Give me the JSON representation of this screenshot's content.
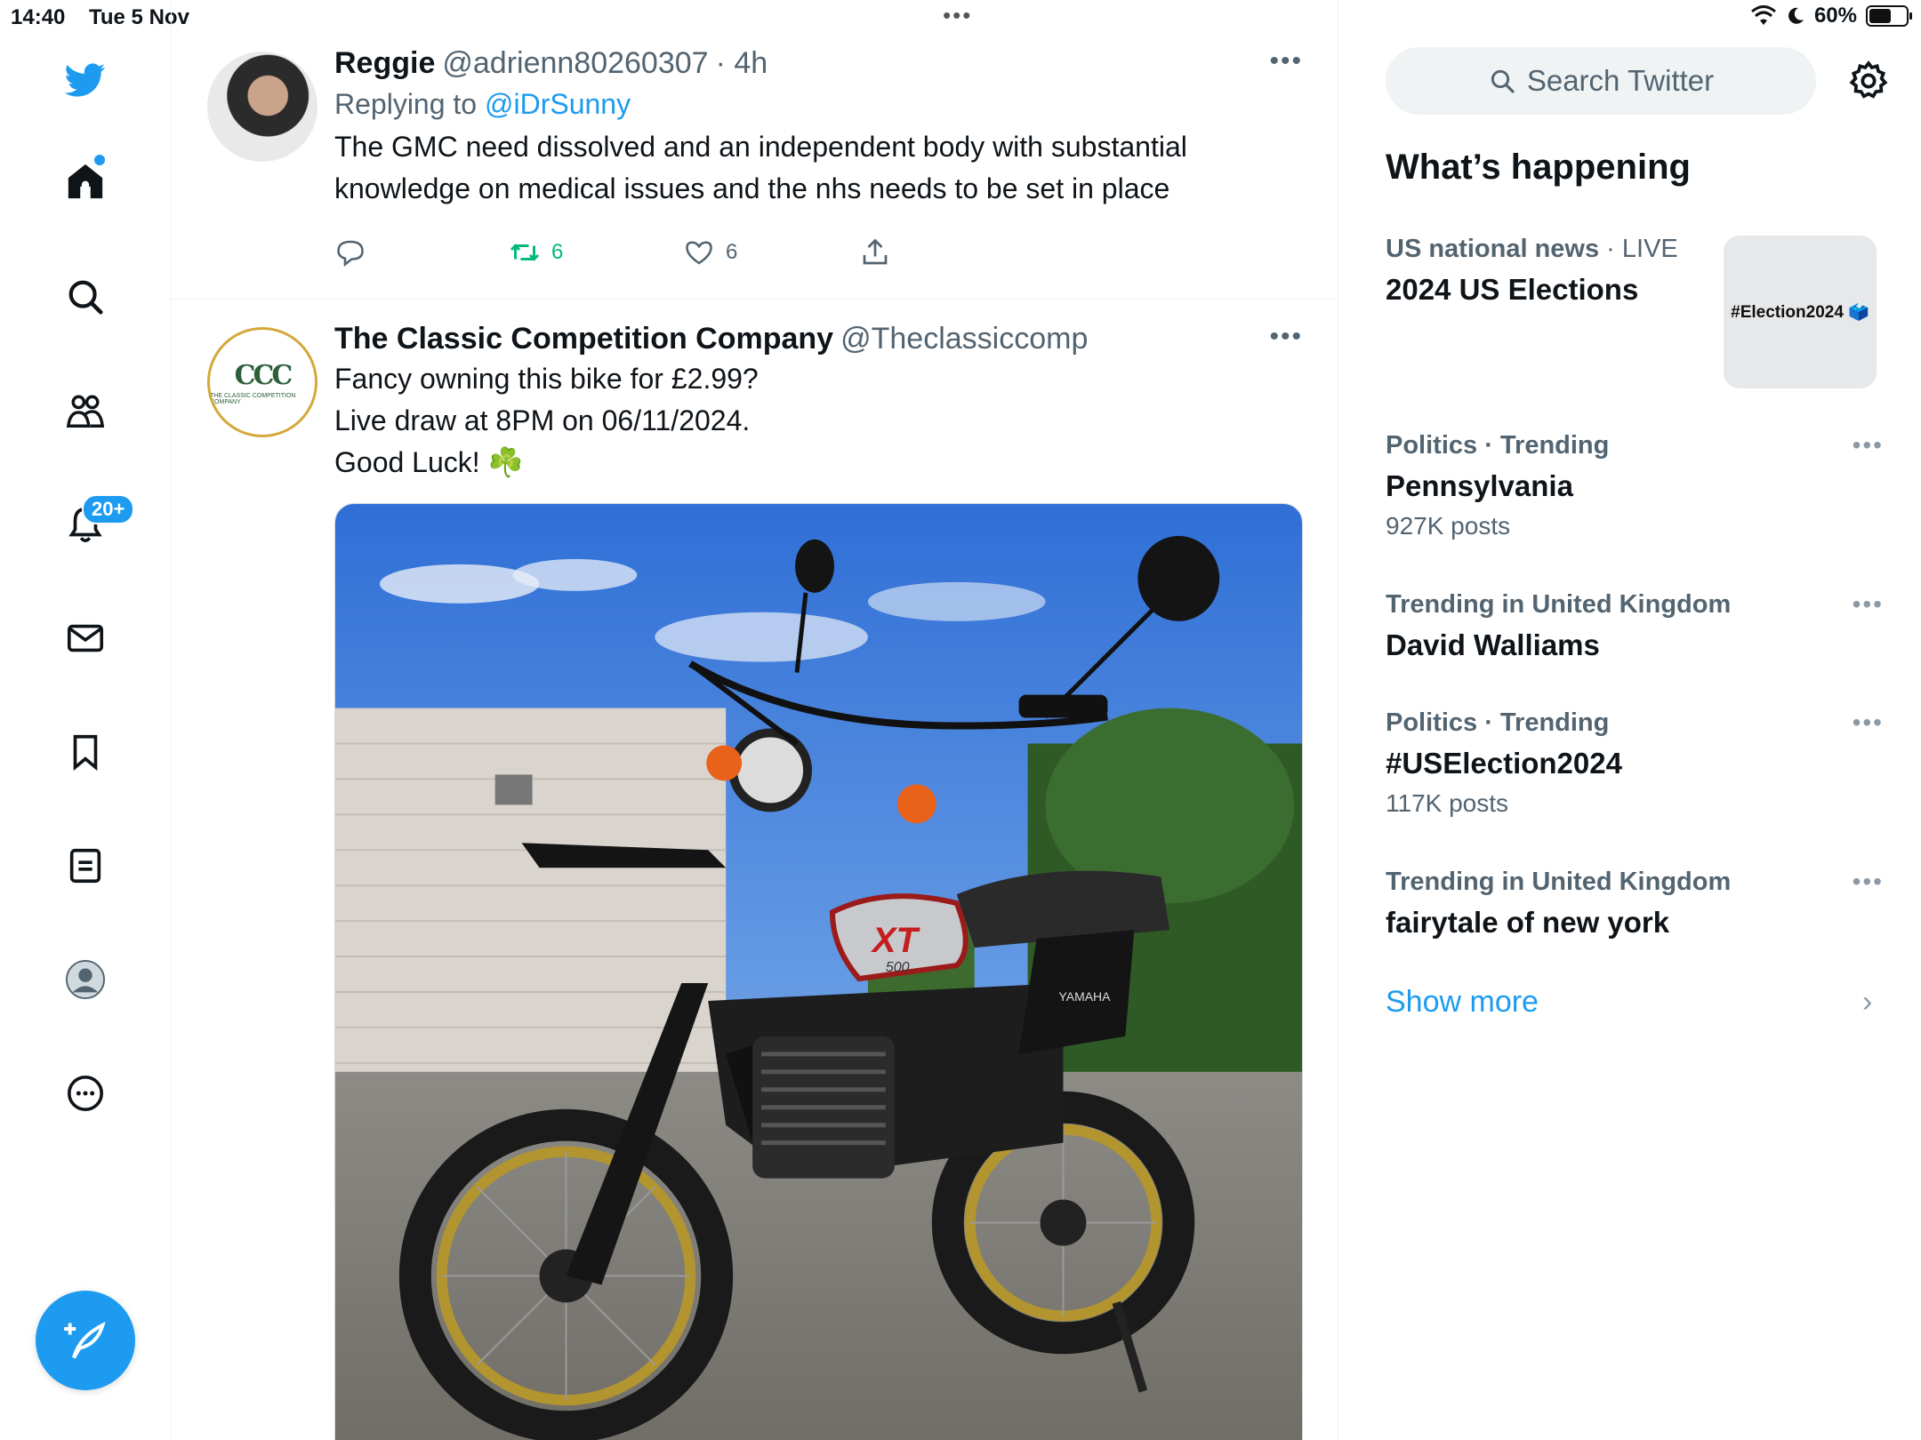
{
  "status_bar": {
    "time": "14:40",
    "date": "Tue 5 Nov",
    "battery": "60%"
  },
  "nav": {
    "notifications_badge": "20+",
    "accent": "#1d9bf0"
  },
  "tweets": [
    {
      "name": "Reggie",
      "handle": "@adrienn80260307",
      "time": "· 4h",
      "reply_prefix": "Replying to",
      "reply_to": "@iDrSunny",
      "text": "The GMC need dissolved and an independent body with substantial\nknowledge on medical issues and the nhs needs to be set in place",
      "retweets": "6",
      "likes": "6"
    },
    {
      "name": "The Classic Competition Company",
      "handle": "@Theclassiccomp",
      "logo_text": "CCC",
      "logo_sub": "THE CLASSIC COMPETITION COMPANY",
      "text": "Fancy owning this bike for £2.99?\nLive draw at 8PM on 06/11/2024.\nGood Luck! ☘️",
      "bike_tank_label": "XT",
      "bike_tank_sub": "500",
      "bike_side_label": "YAMAHA"
    }
  ],
  "sidebar": {
    "search_placeholder": "Search Twitter",
    "section_title": "What’s happening",
    "trends": [
      {
        "meta": "US national news",
        "meta_extra": " · LIVE",
        "name": "2024 US Elections",
        "count": "",
        "image_text": "#Election2024 🗳️"
      },
      {
        "meta": "Politics · Trending",
        "meta_extra": "",
        "name": "Pennsylvania",
        "count": "927K posts"
      },
      {
        "meta": "Trending in United Kingdom",
        "meta_extra": "",
        "name": "David Walliams",
        "count": ""
      },
      {
        "meta": "Politics · Trending",
        "meta_extra": "",
        "name": "#USElection2024",
        "count": "117K posts"
      },
      {
        "meta": "Trending in United Kingdom",
        "meta_extra": "",
        "name": "fairytale of new york",
        "count": ""
      }
    ],
    "show_more": "Show more"
  }
}
